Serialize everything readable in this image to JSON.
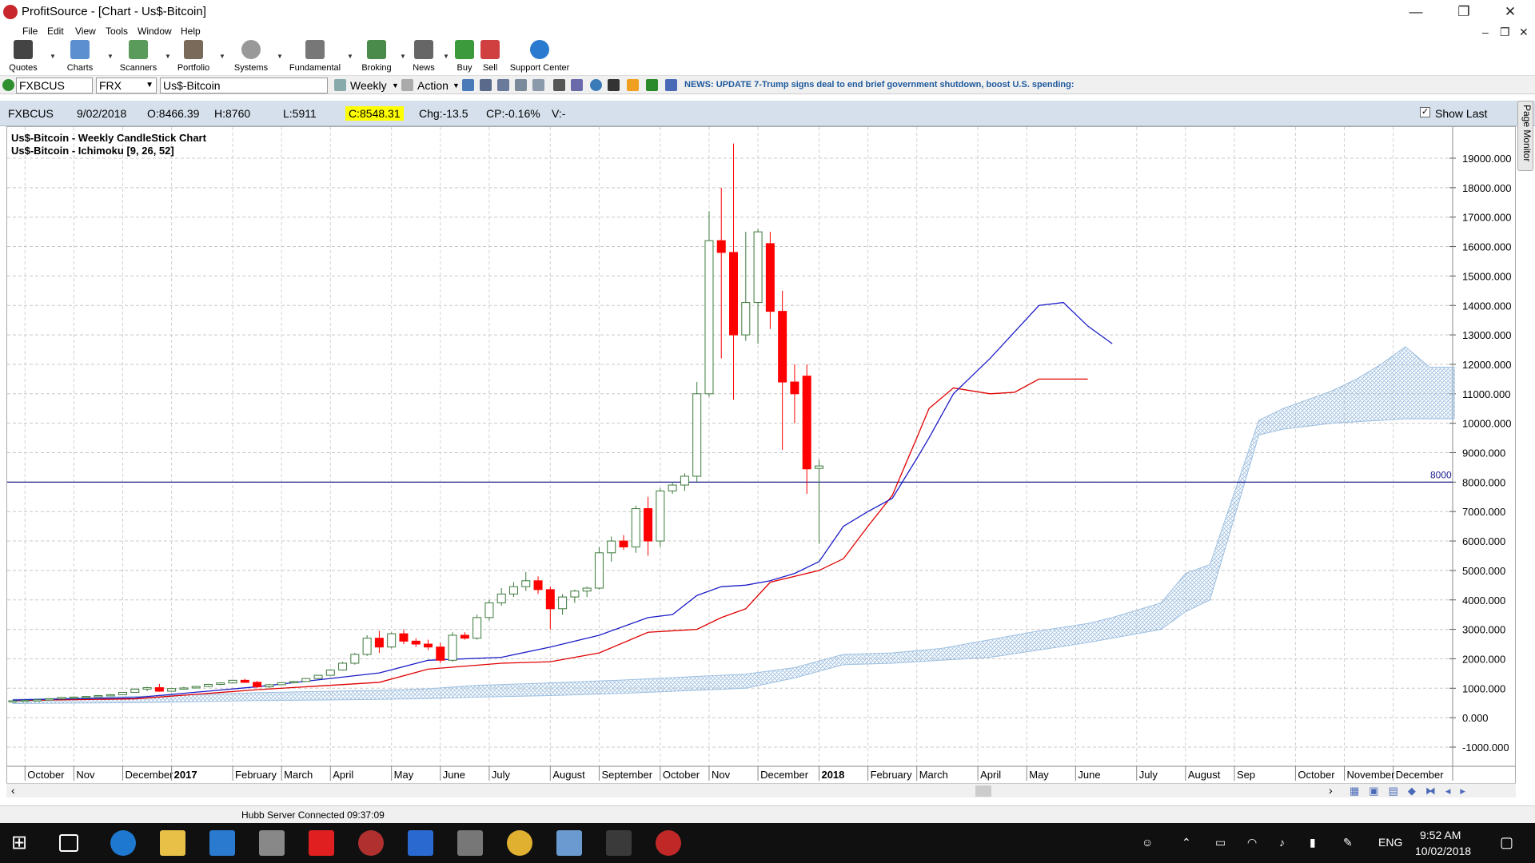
{
  "window": {
    "title": "ProfitSource - [Chart - Us$-Bitcoin]"
  },
  "menu": [
    "File",
    "Edit",
    "View",
    "Tools",
    "Window",
    "Help"
  ],
  "toolbar": [
    {
      "label": "Quotes",
      "icon": "quotes-icon"
    },
    {
      "label": "Charts",
      "icon": "charts-icon"
    },
    {
      "label": "Scanners",
      "icon": "scanners-icon"
    },
    {
      "label": "Portfolio",
      "icon": "portfolio-icon"
    },
    {
      "label": "Systems",
      "icon": "systems-icon"
    },
    {
      "label": "Fundamental",
      "icon": "fundamental-icon"
    },
    {
      "label": "Broking",
      "icon": "broking-icon"
    },
    {
      "label": "News",
      "icon": "news-icon"
    },
    {
      "label": "Buy",
      "icon": "buy-icon"
    },
    {
      "label": "Sell",
      "icon": "sell-icon"
    },
    {
      "label": "Support Center",
      "icon": "help-icon"
    }
  ],
  "symbol_bar": {
    "code": "FXBCUS",
    "exchange": "FRX",
    "name": "Us$-Bitcoin",
    "period": "Weekly",
    "action": "Action",
    "news": "NEWS: UPDATE 7-Trump signs deal to end brief government shutdown, boost U.S. spending:"
  },
  "info_bar": {
    "symbol": "FXBCUS",
    "date": "9/02/2018",
    "open": "O:8466.39",
    "high": "H:8760",
    "low": "L:5911",
    "close": "C:8548.31",
    "change": "Chg:-13.5",
    "change_pct": "CP:-0.16%",
    "volume": "V:-",
    "show_last": "Show Last"
  },
  "page_monitor": "Page Monitor",
  "status": "Hubb Server Connected 09:37:09",
  "taskbar": {
    "lang": "ENG",
    "time": "9:52 AM",
    "date": "10/02/2018"
  },
  "colors": {
    "bull": "#3c7a3c",
    "bear": "#ff0000",
    "tenkan": "#1c1cc8",
    "kijun": "#e00000",
    "cloud": "#9fc0e0",
    "hline": "#1c1c8c"
  },
  "chart_data": {
    "type": "candlestick",
    "title": "Us$-Bitcoin - Weekly CandleStick Chart",
    "subtitle": "Us$-Bitcoin - Ichimoku [9, 26, 52]",
    "ylim": [
      -1500,
      19700
    ],
    "yticks": [
      -1000,
      0,
      1000,
      2000,
      3000,
      4000,
      5000,
      6000,
      7000,
      8000,
      9000,
      10000,
      11000,
      12000,
      13000,
      14000,
      15000,
      16000,
      17000,
      18000,
      19000
    ],
    "ytick_labels": [
      "-1000.000",
      "0.000",
      "1000.000",
      "2000.000",
      "3000.000",
      "4000.000",
      "5000.000",
      "6000.000",
      "7000.000",
      "8000.000",
      "9000.000",
      "10000.000",
      "11000.000",
      "12000.000",
      "13000.000",
      "14000.000",
      "15000.000",
      "16000.000",
      "17000.000",
      "18000.000",
      "19000.000"
    ],
    "xlabels": [
      "October",
      "Nov",
      "December",
      "2017",
      "February",
      "March",
      "April",
      "May",
      "June",
      "July",
      "August",
      "September",
      "October",
      "Nov",
      "December",
      "2018",
      "February",
      "March",
      "April",
      "May",
      "June",
      "July",
      "August",
      "Sep",
      "October",
      "November",
      "December"
    ],
    "xlabel_week": [
      1,
      5,
      9,
      13,
      18,
      22,
      26,
      31,
      35,
      39,
      44,
      48,
      53,
      57,
      61,
      66,
      70,
      74,
      79,
      83,
      87,
      92,
      96,
      100,
      105,
      109,
      113
    ],
    "bold_xlabels": [
      "2017",
      "2018"
    ],
    "hline": {
      "value": 8000,
      "label": "8000"
    },
    "candles": [
      [
        560,
        580,
        555,
        575
      ],
      [
        575,
        600,
        570,
        590
      ],
      [
        590,
        620,
        585,
        610
      ],
      [
        610,
        650,
        600,
        640
      ],
      [
        640,
        700,
        630,
        690
      ],
      [
        690,
        720,
        680,
        700
      ],
      [
        700,
        730,
        690,
        720
      ],
      [
        720,
        760,
        710,
        750
      ],
      [
        750,
        800,
        740,
        780
      ],
      [
        780,
        870,
        770,
        860
      ],
      [
        860,
        1000,
        850,
        970
      ],
      [
        970,
        1050,
        900,
        1020
      ],
      [
        1020,
        1150,
        880,
        900
      ],
      [
        900,
        1000,
        880,
        990
      ],
      [
        990,
        1050,
        960,
        1010
      ],
      [
        1010,
        1080,
        990,
        1060
      ],
      [
        1060,
        1150,
        1040,
        1130
      ],
      [
        1130,
        1200,
        1100,
        1180
      ],
      [
        1180,
        1290,
        1160,
        1270
      ],
      [
        1270,
        1320,
        1180,
        1200
      ],
      [
        1200,
        1250,
        1000,
        1050
      ],
      [
        1050,
        1150,
        1000,
        1120
      ],
      [
        1120,
        1200,
        1100,
        1190
      ],
      [
        1190,
        1250,
        1170,
        1230
      ],
      [
        1230,
        1350,
        1220,
        1330
      ],
      [
        1330,
        1450,
        1310,
        1440
      ],
      [
        1440,
        1650,
        1430,
        1620
      ],
      [
        1620,
        1900,
        1600,
        1850
      ],
      [
        1850,
        2200,
        1800,
        2150
      ],
      [
        2150,
        2800,
        2100,
        2700
      ],
      [
        2700,
        2950,
        2200,
        2400
      ],
      [
        2400,
        2900,
        2350,
        2850
      ],
      [
        2850,
        3000,
        2500,
        2600
      ],
      [
        2600,
        2700,
        2400,
        2500
      ],
      [
        2500,
        2650,
        2300,
        2400
      ],
      [
        2400,
        2550,
        1850,
        1950
      ],
      [
        1950,
        2900,
        1900,
        2800
      ],
      [
        2800,
        2900,
        2650,
        2700
      ],
      [
        2700,
        3500,
        2650,
        3400
      ],
      [
        3400,
        4000,
        3300,
        3900
      ],
      [
        3900,
        4400,
        3800,
        4200
      ],
      [
        4200,
        4600,
        4100,
        4450
      ],
      [
        4450,
        4950,
        4300,
        4650
      ],
      [
        4650,
        4800,
        4200,
        4350
      ],
      [
        4350,
        4450,
        3000,
        3700
      ],
      [
        3700,
        4200,
        3500,
        4100
      ],
      [
        4100,
        4350,
        3900,
        4300
      ],
      [
        4300,
        4450,
        4100,
        4400
      ],
      [
        4400,
        5800,
        4350,
        5600
      ],
      [
        5600,
        6150,
        5300,
        6000
      ],
      [
        6000,
        6200,
        5700,
        5800
      ],
      [
        5800,
        7200,
        5600,
        7100
      ],
      [
        7100,
        7500,
        5500,
        6000
      ],
      [
        6000,
        7800,
        5800,
        7700
      ],
      [
        7700,
        8000,
        7600,
        7900
      ],
      [
        7900,
        8300,
        7700,
        8200
      ],
      [
        8200,
        11400,
        8000,
        11000
      ],
      [
        11000,
        17200,
        10900,
        16200
      ],
      [
        16200,
        18000,
        12200,
        15800
      ],
      [
        15800,
        19500,
        10800,
        13000
      ],
      [
        13000,
        16500,
        12800,
        14100
      ],
      [
        14100,
        16600,
        12700,
        16500
      ],
      [
        16100,
        16500,
        13200,
        13800
      ],
      [
        13800,
        14500,
        9100,
        11400
      ],
      [
        11400,
        12000,
        10000,
        11000
      ],
      [
        11600,
        12000,
        7600,
        8450
      ],
      [
        8466.39,
        8760,
        5911,
        8548.31
      ]
    ],
    "tenkan": [
      [
        0,
        600
      ],
      [
        10,
        680
      ],
      [
        20,
        1050
      ],
      [
        30,
        1520
      ],
      [
        34,
        1950
      ],
      [
        40,
        2050
      ],
      [
        44,
        2400
      ],
      [
        48,
        2800
      ],
      [
        52,
        3400
      ],
      [
        54,
        3500
      ],
      [
        56,
        4150
      ],
      [
        58,
        4450
      ],
      [
        60,
        4500
      ],
      [
        62,
        4650
      ],
      [
        64,
        4900
      ],
      [
        66,
        5300
      ],
      [
        68,
        6500
      ],
      [
        70,
        7000
      ],
      [
        72,
        7450
      ],
      [
        74,
        8800
      ],
      [
        75,
        9500
      ],
      [
        77,
        11000
      ],
      [
        80,
        12200
      ],
      [
        84,
        14000
      ],
      [
        86,
        14100
      ],
      [
        88,
        13300
      ],
      [
        90,
        12700
      ]
    ],
    "kijun": [
      [
        0,
        580
      ],
      [
        10,
        640
      ],
      [
        20,
        950
      ],
      [
        30,
        1200
      ],
      [
        34,
        1650
      ],
      [
        40,
        1850
      ],
      [
        44,
        1900
      ],
      [
        48,
        2200
      ],
      [
        52,
        2900
      ],
      [
        54,
        2950
      ],
      [
        56,
        3000
      ],
      [
        58,
        3400
      ],
      [
        60,
        3700
      ],
      [
        62,
        4600
      ],
      [
        64,
        4800
      ],
      [
        66,
        5000
      ],
      [
        68,
        5400
      ],
      [
        70,
        6500
      ],
      [
        72,
        7550
      ],
      [
        74,
        9500
      ],
      [
        75,
        10500
      ],
      [
        77,
        11200
      ],
      [
        80,
        11000
      ],
      [
        82,
        11050
      ],
      [
        84,
        11500
      ],
      [
        86,
        11500
      ],
      [
        88,
        11500
      ]
    ],
    "cloud_top": [
      [
        0,
        620
      ],
      [
        10,
        720
      ],
      [
        20,
        850
      ],
      [
        30,
        930
      ],
      [
        34,
        980
      ],
      [
        38,
        1100
      ],
      [
        44,
        1180
      ],
      [
        50,
        1280
      ],
      [
        56,
        1400
      ],
      [
        60,
        1480
      ],
      [
        64,
        1700
      ],
      [
        68,
        2150
      ],
      [
        72,
        2200
      ],
      [
        76,
        2350
      ],
      [
        80,
        2650
      ],
      [
        84,
        2950
      ],
      [
        88,
        3200
      ],
      [
        90,
        3400
      ],
      [
        94,
        3900
      ],
      [
        96,
        4900
      ],
      [
        98,
        5200
      ],
      [
        102,
        10100
      ],
      [
        104,
        10500
      ],
      [
        106,
        10800
      ],
      [
        108,
        11100
      ],
      [
        110,
        11500
      ],
      [
        112,
        12000
      ],
      [
        114,
        12600
      ],
      [
        116,
        11900
      ],
      [
        118,
        11900
      ]
    ],
    "cloud_bottom": [
      [
        0,
        480
      ],
      [
        10,
        510
      ],
      [
        20,
        580
      ],
      [
        30,
        620
      ],
      [
        34,
        650
      ],
      [
        38,
        700
      ],
      [
        44,
        750
      ],
      [
        50,
        830
      ],
      [
        56,
        930
      ],
      [
        60,
        1000
      ],
      [
        64,
        1350
      ],
      [
        68,
        1800
      ],
      [
        72,
        1850
      ],
      [
        76,
        1950
      ],
      [
        80,
        2050
      ],
      [
        84,
        2300
      ],
      [
        88,
        2550
      ],
      [
        90,
        2700
      ],
      [
        94,
        3000
      ],
      [
        96,
        3600
      ],
      [
        98,
        4000
      ],
      [
        102,
        9600
      ],
      [
        104,
        9800
      ],
      [
        106,
        9900
      ],
      [
        108,
        10000
      ],
      [
        110,
        10050
      ],
      [
        112,
        10100
      ],
      [
        114,
        10150
      ],
      [
        116,
        10150
      ],
      [
        118,
        10150
      ]
    ]
  }
}
